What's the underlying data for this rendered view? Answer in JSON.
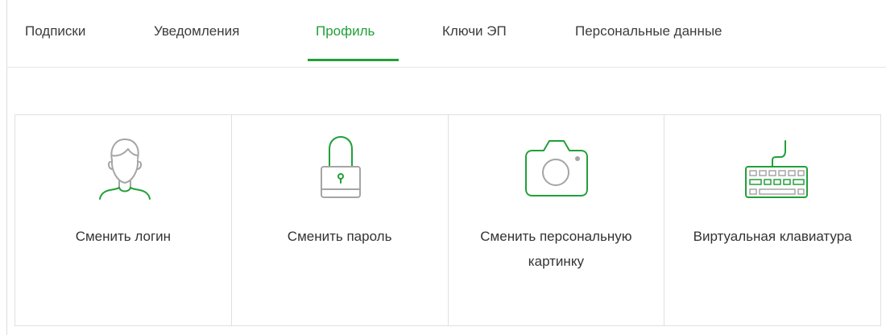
{
  "tabs": {
    "subscriptions": "Подписки",
    "notifications": "Уведомления",
    "profile": "Профиль",
    "keys": "Ключи ЭП",
    "personal_data": "Персональные данные",
    "active": "profile"
  },
  "cards": {
    "change_login": "Сменить логин",
    "change_password": "Сменить пароль",
    "change_picture": "Сменить персональную картинку",
    "virtual_keyboard": "Виртуальная клавиатура"
  },
  "icons": {
    "change_login": "user-icon",
    "change_password": "lock-icon",
    "change_picture": "camera-icon",
    "virtual_keyboard": "keyboard-icon"
  },
  "colors": {
    "accent": "#21a038",
    "icon_gray": "#a5a5a5",
    "text": "#333333",
    "border": "#e0e0e0"
  }
}
